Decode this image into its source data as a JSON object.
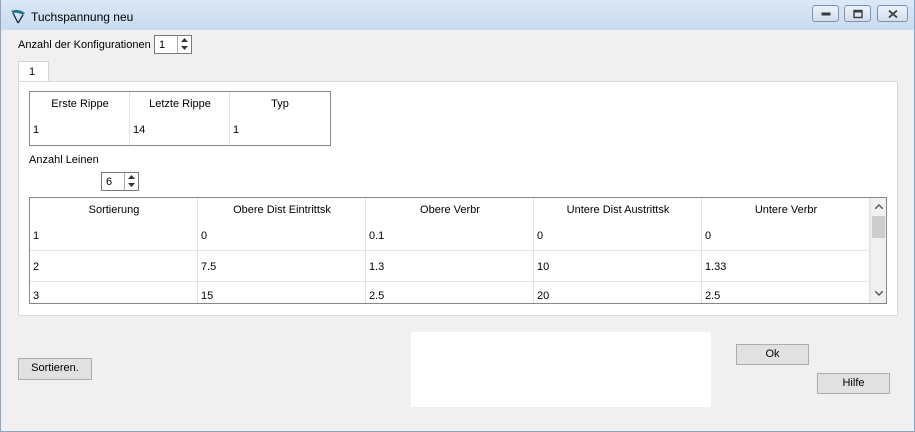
{
  "window": {
    "title": "Tuchspannung neu",
    "icon": "paraglider-app-icon",
    "controls": [
      "minimize-icon",
      "restore-icon",
      "close-icon"
    ]
  },
  "config": {
    "label": "Anzahl der Konfigurationen",
    "value": "1"
  },
  "tabs": [
    {
      "label": "1"
    }
  ],
  "rib_table": {
    "headers": [
      "Erste Rippe",
      "Letzte Rippe",
      "Typ"
    ],
    "rows": [
      [
        "1",
        "14",
        "1"
      ]
    ]
  },
  "lines": {
    "label": "Anzahl Leinen",
    "value": "6"
  },
  "line_table": {
    "headers": [
      "Sortierung",
      "Obere Dist Eintrittsk",
      "Obere Verbr",
      "Untere Dist Austrittsk",
      "Untere Verbr"
    ],
    "rows": [
      [
        "1",
        "0",
        "0.1",
        "0",
        "0"
      ],
      [
        "2",
        "7.5",
        "1.3",
        "10",
        "1.33"
      ],
      [
        "3",
        "15",
        "2.5",
        "20",
        "2.5"
      ]
    ]
  },
  "buttons": {
    "sort": "Sortieren.",
    "ok": "Ok",
    "help": "Hilfe"
  },
  "colors": {
    "titlebar": "#c9dcf0",
    "window_bg": "#f0f0f0",
    "grid_border": "#828790"
  }
}
